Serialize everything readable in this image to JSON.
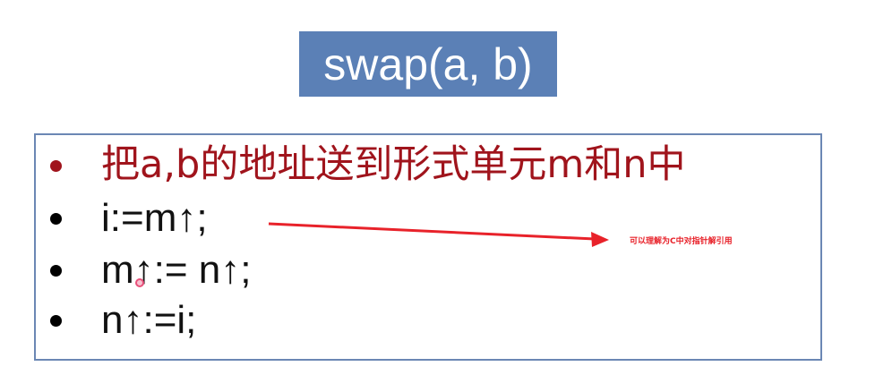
{
  "title": "swap(a, b)",
  "bullets": [
    {
      "text": "把a,b的地址送到形式单元m和n中",
      "color": "#a0141c"
    },
    {
      "text": "i:=m↑;",
      "color": "#111111"
    },
    {
      "text": "m↑:= n↑;",
      "color": "#111111"
    },
    {
      "text": "n↑:=i;",
      "color": "#111111"
    }
  ],
  "annotation": "可以理解为C中对指针解引用",
  "colors": {
    "title_background": "#5b80b6",
    "box_border": "#6b87b4",
    "accent_red": "#a0141c",
    "annotation_red": "#e8222a"
  }
}
